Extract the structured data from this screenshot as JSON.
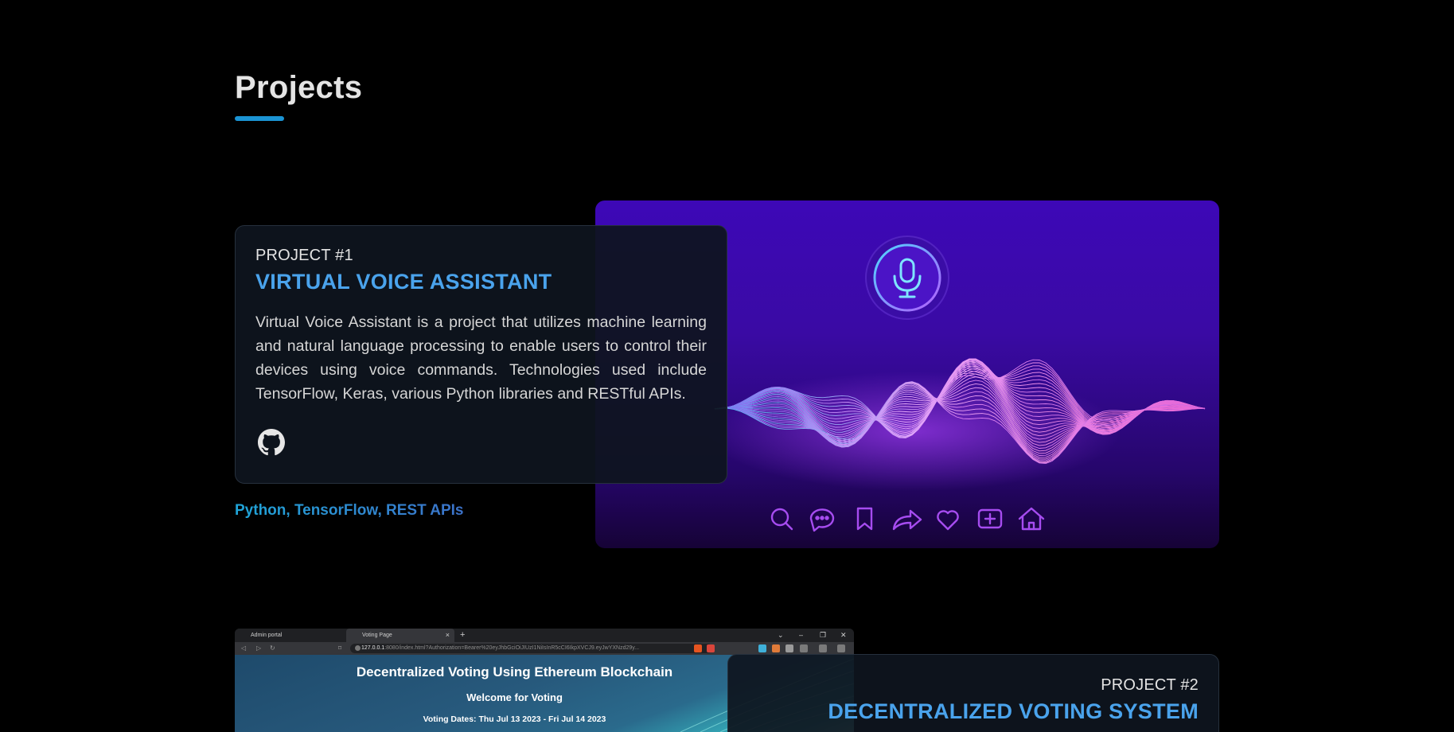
{
  "section": {
    "title": "Projects"
  },
  "projects": [
    {
      "number": "PROJECT #1",
      "title": "VIRTUAL VOICE ASSISTANT",
      "description": "Virtual Voice Assistant is a project that utilizes machine learning and natural language processing to enable users to control their devices using voice commands. Technologies used include TensorFlow, Keras, various Python libraries and RESTful APIs.",
      "tags": "Python, TensorFlow, REST APIs",
      "link_icon": "github-icon",
      "image": {
        "mic_icon": "microphone-icon",
        "toolbar_icons": [
          "search-icon",
          "chat-bubble-icon",
          "bookmark-icon",
          "share-icon",
          "heart-icon",
          "add-square-icon",
          "home-icon"
        ]
      }
    },
    {
      "number": "PROJECT #2",
      "title": "DECENTRALIZED VOTING SYSTEM",
      "screenshot": {
        "tabs": [
          "Admin portal",
          "Voting Page"
        ],
        "url_host": "127.0.0.1",
        "url_path": ":8080/index.html?Authorization=Bearer%20eyJhbGciOiJIUzI1NiIsInR5cCI6IkpXVCJ9.eyJwYXNzd29y...",
        "heading": "Decentralized Voting Using Ethereum Blockchain",
        "subheading": "Welcome for Voting",
        "dates": "Voting Dates: Thu Jul 13 2023 - Fri Jul 14 2023"
      }
    }
  ],
  "colors": {
    "accent": "#1b94d4",
    "title_blue": "#4aa3ec",
    "card_bg": "#0e141e",
    "page_bg": "#000000",
    "icon_purple": "#a64cf0"
  }
}
